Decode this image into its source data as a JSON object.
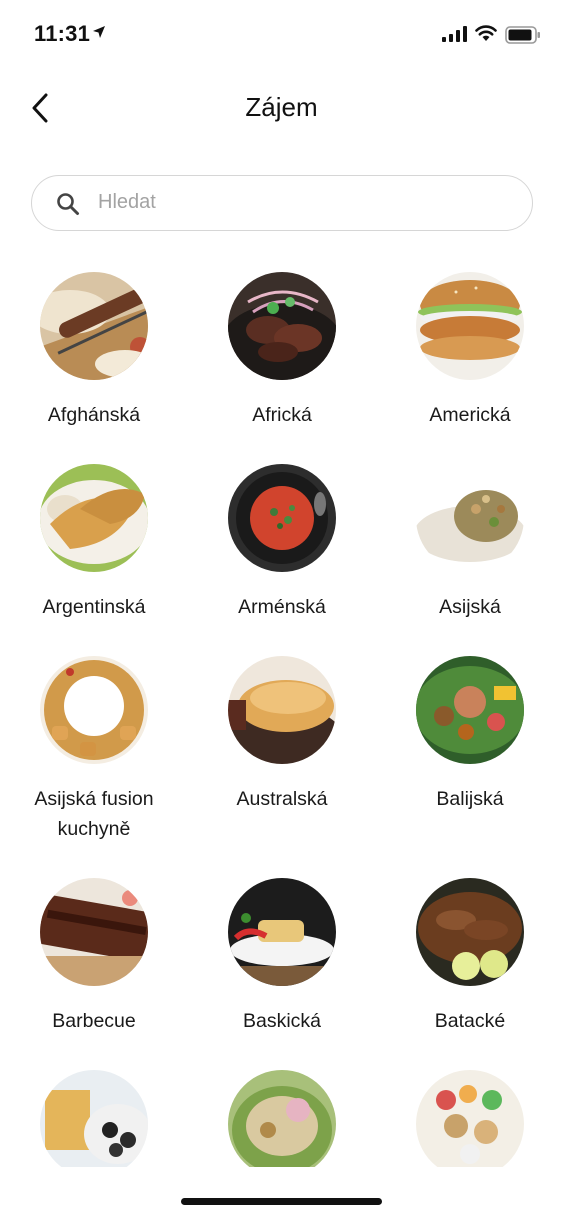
{
  "status": {
    "time": "11:31"
  },
  "nav": {
    "title": "Zájem"
  },
  "search": {
    "placeholder": "Hledat",
    "value": ""
  },
  "cuisines": [
    {
      "label": "Afghánská"
    },
    {
      "label": "Africká"
    },
    {
      "label": "Americká"
    },
    {
      "label": "Argentinská"
    },
    {
      "label": "Arménská"
    },
    {
      "label": "Asijská"
    },
    {
      "label": "Asijská fusion kuchyně"
    },
    {
      "label": "Australská"
    },
    {
      "label": "Balijská"
    },
    {
      "label": "Barbecue"
    },
    {
      "label": "Baskická"
    },
    {
      "label": "Batacké"
    },
    {
      "label": ""
    },
    {
      "label": ""
    },
    {
      "label": ""
    }
  ]
}
